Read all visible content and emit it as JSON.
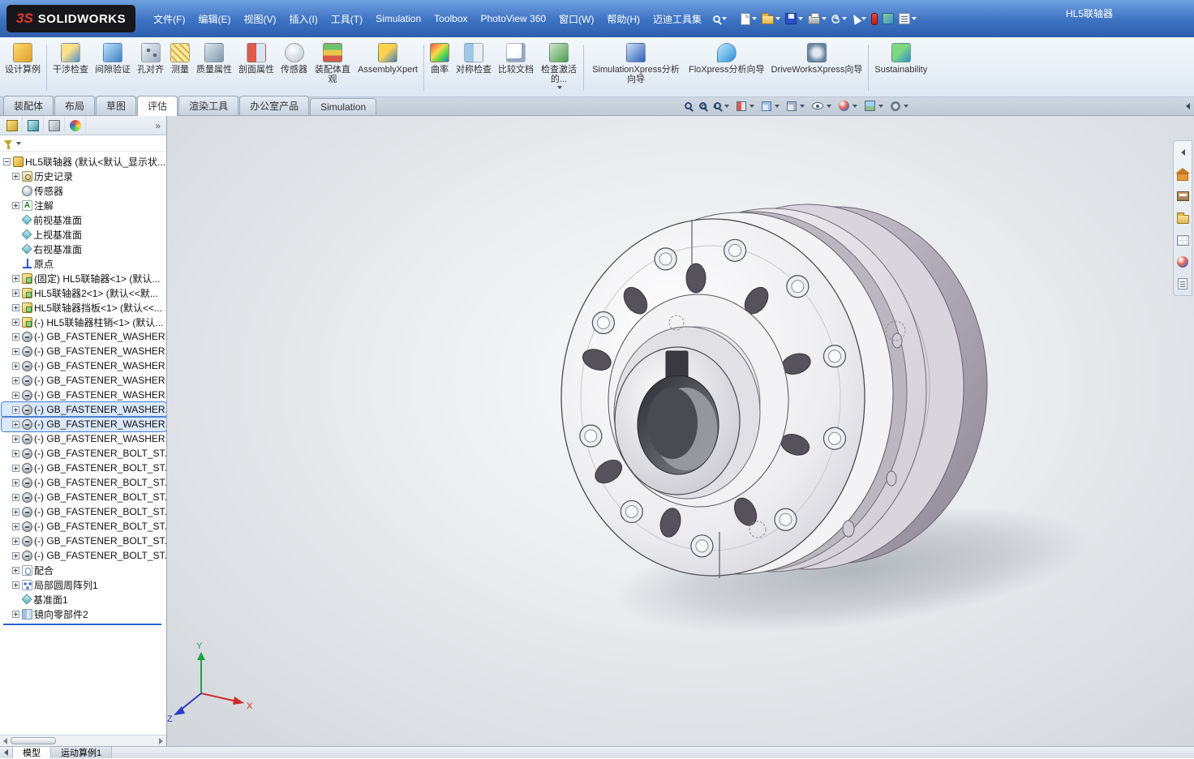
{
  "app": {
    "logo_mark": "3S",
    "brand": "SOLIDWORKS",
    "doc_title": "HL5联轴器"
  },
  "colors": {
    "titlebar_blue": "#3c72c2",
    "selection_blue": "#4a7fd0",
    "accent_red": "#e03a2f",
    "viewport_grey": "#d2d6db",
    "rollback_blue": "#2a5fd0"
  },
  "menubar": {
    "items": [
      "文件(F)",
      "编辑(E)",
      "视图(V)",
      "插入(I)",
      "工具(T)",
      "Simulation",
      "Toolbox",
      "PhotoView 360",
      "窗口(W)",
      "帮助(H)",
      "迈迪工具集"
    ]
  },
  "quick_toolbar": {
    "icons": [
      {
        "name": "new-document-icon",
        "caret": true
      },
      {
        "name": "open-icon",
        "caret": true
      },
      {
        "name": "save-icon",
        "caret": true
      },
      {
        "name": "print-icon",
        "caret": true
      },
      {
        "name": "undo-icon",
        "caret": true
      },
      {
        "name": "select-icon",
        "caret": true
      },
      {
        "name": "rebuild-icon",
        "caret": false
      },
      {
        "name": "appearance-icon",
        "caret": false
      },
      {
        "name": "options-icon",
        "caret": true
      }
    ]
  },
  "ribbon": {
    "buttons": [
      {
        "label": "设计算例",
        "icon": "design-study-icon"
      },
      {
        "label": "干涉检查",
        "icon": "interference-check-icon",
        "sep_before": true
      },
      {
        "label": "间隙验证",
        "icon": "clearance-verify-icon"
      },
      {
        "label": "孔对齐",
        "icon": "hole-alignment-icon"
      },
      {
        "label": "测量",
        "icon": "measure-icon"
      },
      {
        "label": "质量属性",
        "icon": "mass-properties-icon"
      },
      {
        "label": "剖面属性",
        "icon": "section-properties-icon"
      },
      {
        "label": "传感器",
        "icon": "sensor-icon"
      },
      {
        "label": "装配体直观",
        "icon": "assembly-visualization-icon"
      },
      {
        "label": "AssemblyXpert",
        "icon": "assembly-xpert-icon",
        "wide": true
      },
      {
        "label": "曲率",
        "icon": "curvature-icon",
        "sep_before": true
      },
      {
        "label": "对称检查",
        "icon": "symmetry-check-icon"
      },
      {
        "label": "比较文档",
        "icon": "compare-documents-icon"
      },
      {
        "label": "检查激活的...",
        "icon": "check-active-icon",
        "caret": true
      },
      {
        "label": "SimulationXpress分析向导",
        "icon": "simulationxpress-icon",
        "wide": true,
        "sep_before": true
      },
      {
        "label": "FloXpress分析向导",
        "icon": "floxpress-icon",
        "wide": true
      },
      {
        "label": "DriveWorksXpress向导",
        "icon": "driveworks-icon",
        "wide": true
      },
      {
        "label": "Sustainability",
        "icon": "sustainability-icon",
        "wide": true,
        "sep_before": true
      }
    ]
  },
  "command_tabs": {
    "tabs": [
      {
        "label": "装配体"
      },
      {
        "label": "布局"
      },
      {
        "label": "草图"
      },
      {
        "label": "评估",
        "active": true
      },
      {
        "label": "渲染工具"
      },
      {
        "label": "办公室产品"
      },
      {
        "label": "Simulation"
      }
    ]
  },
  "headsup": {
    "icons": [
      {
        "name": "zoom-fit-icon"
      },
      {
        "name": "zoom-area-icon"
      },
      {
        "name": "previous-view-icon",
        "caret": true
      },
      {
        "name": "section-view-icon",
        "caret": true
      },
      {
        "name": "view-orientation-icon",
        "caret": true
      },
      {
        "name": "display-style-icon",
        "caret": true
      },
      {
        "name": "hide-show-items-icon",
        "caret": true
      },
      {
        "name": "edit-appearance-icon",
        "caret": true
      },
      {
        "name": "apply-scene-icon",
        "caret": true
      },
      {
        "name": "view-settings-icon",
        "caret": true
      }
    ]
  },
  "panel_tabs": {
    "icons": [
      {
        "name": "featuremanager-tab-icon"
      },
      {
        "name": "propertymanager-tab-icon"
      },
      {
        "name": "configurationmanager-tab-icon"
      },
      {
        "name": "displaymanager-tab-icon"
      }
    ]
  },
  "feature_tree": {
    "root": {
      "label": "HL5联轴器 (默认<默认_显示状...",
      "icon": "assembly-icon",
      "expand": "minus"
    },
    "items": [
      {
        "label": "历史记录",
        "icon": "history-icon",
        "expand": true
      },
      {
        "label": "传感器",
        "icon": "sensor-icon",
        "expand": false
      },
      {
        "label": "注解",
        "icon": "annotation-icon",
        "expand": true
      },
      {
        "label": "前视基准面",
        "icon": "plane-icon",
        "expand": false
      },
      {
        "label": "上视基准面",
        "icon": "plane-icon",
        "expand": false
      },
      {
        "label": "右视基准面",
        "icon": "plane-icon",
        "expand": false
      },
      {
        "label": "原点",
        "icon": "origin-icon",
        "expand": false
      },
      {
        "label": "(固定) HL5联轴器<1> (默认...",
        "icon": "part-icon",
        "expand": true
      },
      {
        "label": "HL5联轴器2<1> (默认<<默...",
        "icon": "part-icon",
        "expand": true
      },
      {
        "label": "HL5联轴器挡板<1> (默认<<...",
        "icon": "part-icon",
        "expand": true
      },
      {
        "label": "(-) HL5联轴器柱销<1> (默认...",
        "icon": "part-icon",
        "expand": true
      },
      {
        "label": "(-) GB_FASTENER_WASHER...",
        "icon": "fastener-icon",
        "expand": true
      },
      {
        "label": "(-) GB_FASTENER_WASHER...",
        "icon": "fastener-icon",
        "expand": true
      },
      {
        "label": "(-) GB_FASTENER_WASHER...",
        "icon": "fastener-icon",
        "expand": true
      },
      {
        "label": "(-) GB_FASTENER_WASHER...",
        "icon": "fastener-icon",
        "expand": true
      },
      {
        "label": "(-) GB_FASTENER_WASHER...",
        "icon": "fastener-icon",
        "expand": true
      },
      {
        "label": "(-) GB_FASTENER_WASHER...",
        "icon": "fastener-icon",
        "expand": true,
        "selected": true
      },
      {
        "label": "(-) GB_FASTENER_WASHER...",
        "icon": "fastener-icon",
        "expand": true,
        "selected": true
      },
      {
        "label": "(-) GB_FASTENER_WASHER...",
        "icon": "fastener-icon",
        "expand": true
      },
      {
        "label": "(-) GB_FASTENER_BOLT_ST...",
        "icon": "fastener-icon",
        "expand": true
      },
      {
        "label": "(-) GB_FASTENER_BOLT_ST...",
        "icon": "fastener-icon",
        "expand": true
      },
      {
        "label": "(-) GB_FASTENER_BOLT_ST...",
        "icon": "fastener-icon",
        "expand": true
      },
      {
        "label": "(-) GB_FASTENER_BOLT_ST...",
        "icon": "fastener-icon",
        "expand": true
      },
      {
        "label": "(-) GB_FASTENER_BOLT_ST...",
        "icon": "fastener-icon",
        "expand": true
      },
      {
        "label": "(-) GB_FASTENER_BOLT_ST...",
        "icon": "fastener-icon",
        "expand": true
      },
      {
        "label": "(-) GB_FASTENER_BOLT_ST...",
        "icon": "fastener-icon",
        "expand": true
      },
      {
        "label": "(-) GB_FASTENER_BOLT_ST...",
        "icon": "fastener-icon",
        "expand": true
      },
      {
        "label": "配合",
        "icon": "mates-icon",
        "expand": true
      },
      {
        "label": "局部圆周阵列1",
        "icon": "pattern-icon",
        "expand": true
      },
      {
        "label": "基准面1",
        "icon": "plane-icon",
        "expand": false
      },
      {
        "label": "镜向零部件2",
        "icon": "mirror-icon",
        "expand": true
      }
    ]
  },
  "taskpane": {
    "icons": [
      {
        "name": "collapse-panel-icon"
      },
      {
        "name": "solidworks-resources-icon"
      },
      {
        "name": "design-library-icon"
      },
      {
        "name": "file-explorer-icon"
      },
      {
        "name": "view-palette-icon"
      },
      {
        "name": "appearances-scenes-icon"
      },
      {
        "name": "custom-properties-icon"
      }
    ]
  },
  "triad": {
    "x_label": "X",
    "y_label": "Y",
    "z_label": "Z"
  },
  "statusbar": {
    "tabs": [
      {
        "label": "模型",
        "active": true
      },
      {
        "label": "运动算例1",
        "active": false
      }
    ]
  }
}
